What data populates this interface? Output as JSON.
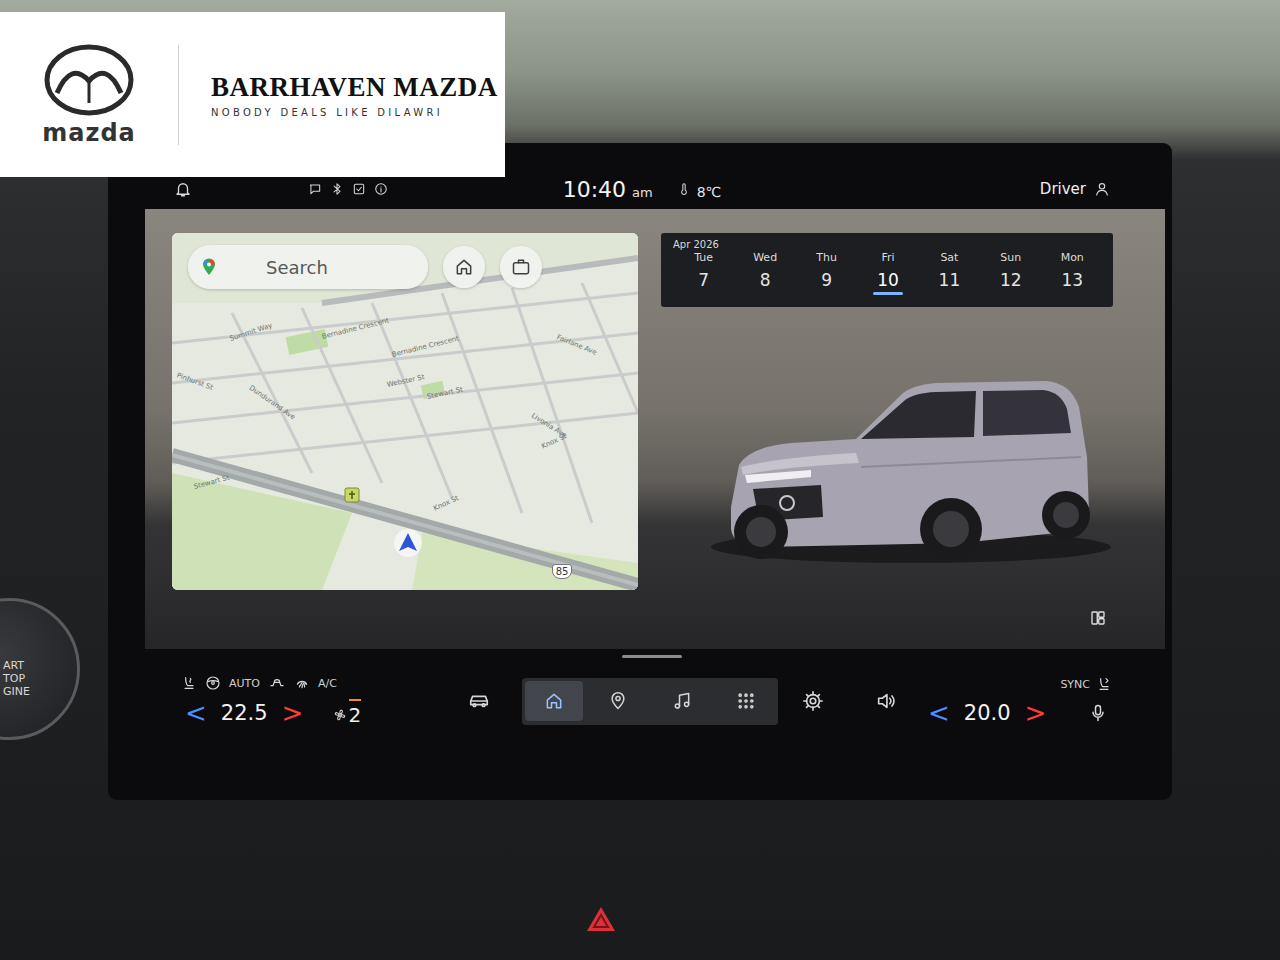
{
  "dealer": {
    "brand": "mazda",
    "name": "BARRHAVEN MAZDA",
    "tagline": "NOBODY DEALS LIKE DILAWRI"
  },
  "start_button": {
    "lines": [
      "ART",
      "TOP",
      "GINE"
    ]
  },
  "status_bar": {
    "time": "10:40",
    "ampm": "am",
    "temperature": "8℃",
    "profile": "Driver"
  },
  "map": {
    "search_placeholder": "Search",
    "route": "85",
    "streets": [
      {
        "label": "Summit Way"
      },
      {
        "label": "Bernadine Crescent"
      },
      {
        "label": "Bernadine Crescent"
      },
      {
        "label": "Fairlane Ave"
      },
      {
        "label": "Pinhurst St"
      },
      {
        "label": "Dundurand Ave"
      },
      {
        "label": "Webster St"
      },
      {
        "label": "Stewart St"
      },
      {
        "label": "Livonia Ave"
      },
      {
        "label": "Knox St"
      },
      {
        "label": "Stewart St"
      },
      {
        "label": "Knox St"
      }
    ]
  },
  "calendar": {
    "month": "Apr 2026",
    "days": [
      {
        "weekday": "Tue",
        "day": "7",
        "selected": false
      },
      {
        "weekday": "Wed",
        "day": "8",
        "selected": false
      },
      {
        "weekday": "Thu",
        "day": "9",
        "selected": false
      },
      {
        "weekday": "Fri",
        "day": "10",
        "selected": true
      },
      {
        "weekday": "Sat",
        "day": "11",
        "selected": false
      },
      {
        "weekday": "Sun",
        "day": "12",
        "selected": false
      },
      {
        "weekday": "Mon",
        "day": "13",
        "selected": false
      }
    ]
  },
  "climate": {
    "auto": "AUTO",
    "ac": "A/C",
    "sync": "SYNC",
    "fan_speed": "2",
    "fan_on": true,
    "driver": {
      "down": "<",
      "temp": "22.5",
      "up": ">"
    },
    "passenger": {
      "down": "<",
      "temp": "20.0",
      "up": ">"
    }
  },
  "dock": [
    {
      "kind": "home",
      "selected": true
    },
    {
      "kind": "pin",
      "selected": false
    },
    {
      "kind": "music",
      "selected": false
    },
    {
      "kind": "apps",
      "selected": false
    }
  ]
}
